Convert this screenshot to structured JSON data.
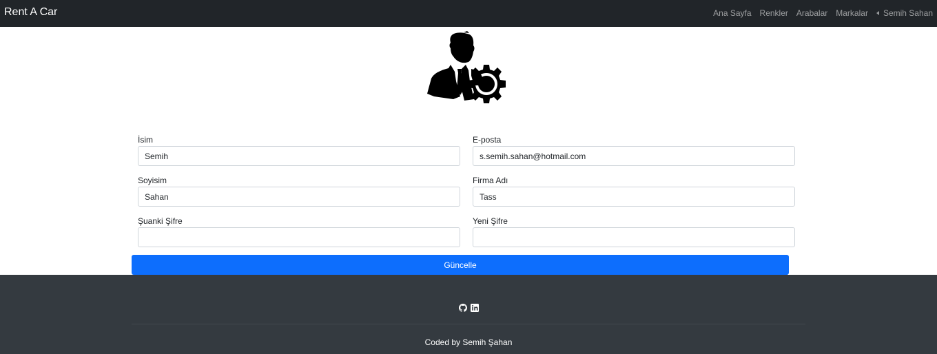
{
  "navbar": {
    "brand": "Rent A Car",
    "links": [
      "Ana Sayfa",
      "Renkler",
      "Arabalar",
      "Markalar"
    ],
    "user": "Semih Sahan"
  },
  "icons": {
    "profile": "user-settings-icon",
    "user_menu": "caret-left-icon",
    "github": "github-icon",
    "linkedin": "linkedin-icon"
  },
  "form": {
    "first_name": {
      "label": "İsim",
      "value": "Semih"
    },
    "email": {
      "label": "E-posta",
      "value": "s.semih.sahan@hotmail.com"
    },
    "last_name": {
      "label": "Soyisim",
      "value": "Sahan"
    },
    "company": {
      "label": "Firma Adı",
      "value": "Tass"
    },
    "current_password": {
      "label": "Şuanki Şifre",
      "value": ""
    },
    "new_password": {
      "label": "Yeni Şifre",
      "value": ""
    },
    "submit_label": "Güncelle"
  },
  "footer": {
    "credit": "Coded by Semih Şahan"
  },
  "colors": {
    "navbar_bg": "#212529",
    "footer_bg": "#343a40",
    "primary": "#0d6efd"
  }
}
